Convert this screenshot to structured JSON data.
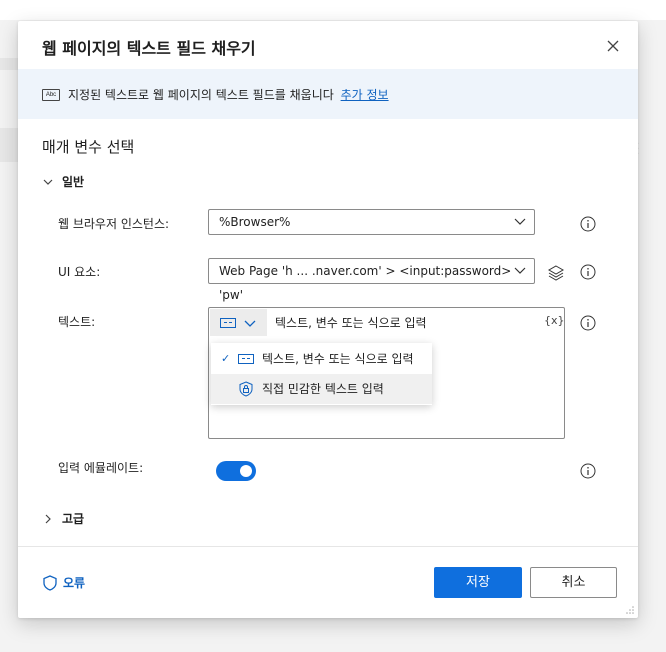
{
  "dialog": {
    "title": "웹 페이지의 텍스트 필드 채우기",
    "banner_text": "지정된 텍스트로 웹 페이지의 텍스트 필드를 채웁니다",
    "banner_link": "추가 정보",
    "banner_icon_text": "Abc"
  },
  "params": {
    "section_title": "매개 변수 선택",
    "group_general": "일반",
    "browser_label": "웹 브라우저 인스턴스:",
    "browser_value": "%Browser%",
    "ui_label": "UI 요소:",
    "ui_value": "Web Page 'h ... .naver.com' > <input:password> 'pw'",
    "text_label": "텍스트:",
    "text_placeholder": "텍스트, 변수 또는 식으로 입력",
    "var_button": "{x}",
    "menu": [
      {
        "label": "텍스트, 변수 또는 식으로 입력",
        "checked": true
      },
      {
        "label": "직접 민감한 텍스트 입력",
        "checked": false
      }
    ],
    "emulate_label": "입력 에뮬레이트:",
    "emulate_on": true,
    "group_advanced": "고급"
  },
  "footer": {
    "error_link": "오류",
    "save": "저장",
    "cancel": "취소"
  },
  "colors": {
    "accent": "#0f6fde",
    "link": "#0f62c0",
    "banner": "#eef4fb"
  }
}
